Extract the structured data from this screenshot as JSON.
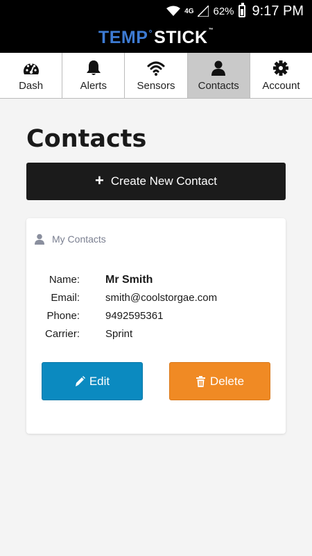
{
  "status_bar": {
    "network": "4G",
    "battery_percent": "62%",
    "time": "9:17 PM"
  },
  "brand": {
    "part1": "TEMP",
    "degree": "°",
    "part2": "STICK",
    "tm": "™",
    "colors": {
      "temp": "#3d7bd3",
      "stick": "#ffffff"
    }
  },
  "nav": {
    "tabs": [
      {
        "label": "Dash",
        "icon": "dashboard-gauge-icon",
        "active": false
      },
      {
        "label": "Alerts",
        "icon": "bell-icon",
        "active": false
      },
      {
        "label": "Sensors",
        "icon": "wifi-icon",
        "active": false
      },
      {
        "label": "Contacts",
        "icon": "user-icon",
        "active": true
      },
      {
        "label": "Account",
        "icon": "gear-icon",
        "active": false
      }
    ]
  },
  "page": {
    "title": "Contacts",
    "create_button": "Create New Contact"
  },
  "card": {
    "header": "My Contacts",
    "fields": [
      {
        "key": "Name:",
        "value": "Mr Smith"
      },
      {
        "key": "Email:",
        "value": "smith@coolstorgae.com"
      },
      {
        "key": "Phone:",
        "value": "9492595361"
      },
      {
        "key": "Carrier:",
        "value": "Sprint"
      }
    ],
    "edit_button": "Edit",
    "delete_button": "Delete"
  },
  "colors": {
    "edit": "#0b8ac0",
    "delete": "#f08a24",
    "create": "#1b1b1b",
    "active_tab": "#c9c9c9"
  }
}
